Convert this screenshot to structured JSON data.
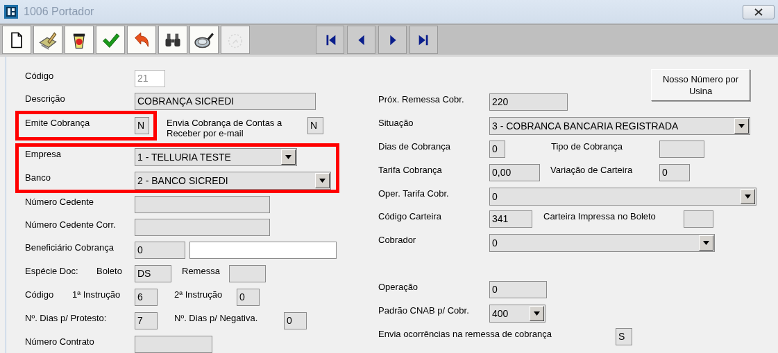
{
  "window": {
    "title": "1006 Portador"
  },
  "toolbar": [
    {
      "disabled": false
    },
    {
      "disabled": false
    },
    {
      "disabled": false
    },
    {
      "disabled": false
    },
    {
      "disabled": false
    },
    {
      "disabled": false
    },
    {
      "disabled": false
    },
    {
      "disabled": true
    }
  ],
  "left_rows": [
    {
      "kind": "row",
      "highlighted": false,
      "cells": [
        {
          "kind": "label",
          "text": "Código"
        },
        {
          "kind": "field",
          "value": "21",
          "readonly": false,
          "disabled": true
        }
      ]
    },
    {
      "kind": "row",
      "highlighted": false,
      "cells": [
        {
          "kind": "label",
          "text": "Descrição"
        },
        {
          "kind": "field",
          "value": "COBRANÇA SICREDI",
          "readonly": true,
          "disabled": false
        }
      ]
    },
    {
      "kind": "row",
      "highlighted": true,
      "cells": [
        {
          "kind": "label",
          "text": "Emite Cobrança"
        },
        {
          "kind": "field",
          "value": "N",
          "readonly": true,
          "disabled": false
        },
        {
          "kind": "label",
          "text": "Envia Cobrança de Contas a Receber por e-mail"
        },
        {
          "kind": "field",
          "value": "N",
          "readonly": true,
          "disabled": false
        }
      ]
    },
    {
      "kind": "group",
      "highlighted": true,
      "rows": [
        {
          "kind": "row",
          "highlighted": false,
          "cells": [
            {
              "kind": "label",
              "text": "Empresa"
            },
            {
              "kind": "combo",
              "value": "1 - TELLURIA TESTE"
            }
          ]
        },
        {
          "kind": "row",
          "highlighted": false,
          "cells": [
            {
              "kind": "label",
              "text": "Banco"
            },
            {
              "kind": "combo",
              "value": "2 - BANCO SICREDI"
            }
          ]
        }
      ]
    },
    {
      "kind": "row",
      "highlighted": false,
      "cells": [
        {
          "kind": "label",
          "text": "Número Cedente"
        },
        {
          "kind": "field",
          "readonly": true,
          "disabled": false
        }
      ]
    },
    {
      "kind": "row",
      "highlighted": false,
      "cells": [
        {
          "kind": "label",
          "text": "Número Cedente Corr."
        },
        {
          "kind": "field",
          "readonly": true,
          "disabled": false
        }
      ]
    },
    {
      "kind": "row",
      "highlighted": false,
      "cells": [
        {
          "kind": "label",
          "text": "Beneficiário Cobrança"
        },
        {
          "kind": "field",
          "value": "0",
          "readonly": true,
          "disabled": false
        },
        {
          "kind": "field",
          "readonly": false,
          "disabled": false
        }
      ]
    },
    {
      "kind": "row",
      "highlighted": false,
      "cells": [
        {
          "kind": "label",
          "text": "Espécie Doc:"
        },
        {
          "kind": "label",
          "text": "Boleto"
        },
        {
          "kind": "field",
          "value": "DS",
          "readonly": true,
          "disabled": false
        },
        {
          "kind": "label",
          "text": "Remessa"
        },
        {
          "kind": "field",
          "readonly": true,
          "disabled": false
        }
      ]
    },
    {
      "kind": "row",
      "highlighted": false,
      "cells": [
        {
          "kind": "label",
          "text": "Código"
        },
        {
          "kind": "label",
          "text": "1ª Instrução"
        },
        {
          "kind": "field",
          "value": "6",
          "readonly": true,
          "disabled": false
        },
        {
          "kind": "label",
          "text": "2ª Instrução"
        },
        {
          "kind": "field",
          "value": "0",
          "readonly": true,
          "disabled": false
        }
      ]
    },
    {
      "kind": "row",
      "highlighted": false,
      "cells": [
        {
          "kind": "label",
          "text": "Nº. Dias p/ Protesto:"
        },
        {
          "kind": "field",
          "value": "7",
          "readonly": true,
          "disabled": false
        },
        {
          "kind": "label",
          "text": "Nº. Dias p/ Negativa."
        },
        {
          "kind": "field",
          "value": "0",
          "readonly": true,
          "disabled": false
        }
      ]
    },
    {
      "kind": "row",
      "highlighted": false,
      "cells": [
        {
          "kind": "label",
          "text": "Número Contrato"
        },
        {
          "kind": "field",
          "readonly": true,
          "disabled": false
        }
      ]
    }
  ],
  "button": {
    "label": "Nosso Número por Usina"
  },
  "right_rows": [
    {
      "kind": "row",
      "highlighted": false,
      "cells": [
        {
          "kind": "label",
          "text": "Próx. Remessa Cobr."
        },
        {
          "kind": "field",
          "value": "220",
          "readonly": true,
          "disabled": false
        }
      ]
    },
    {
      "kind": "row",
      "highlighted": false,
      "cells": [
        {
          "kind": "label",
          "text": "Situação"
        },
        {
          "kind": "combo",
          "value": "3 - COBRANCA BANCARIA REGISTRADA"
        }
      ]
    },
    {
      "kind": "row",
      "highlighted": false,
      "cells": [
        {
          "kind": "label",
          "text": "Dias de Cobrança"
        },
        {
          "kind": "field",
          "value": "0",
          "readonly": true,
          "disabled": false
        },
        {
          "kind": "label",
          "text": "Tipo de Cobrança"
        },
        {
          "kind": "field",
          "readonly": true,
          "disabled": false
        }
      ]
    },
    {
      "kind": "row",
      "highlighted": false,
      "cells": [
        {
          "kind": "label",
          "text": "Tarifa Cobrança"
        },
        {
          "kind": "field",
          "value": "0,00",
          "readonly": true,
          "disabled": false
        },
        {
          "kind": "label",
          "text": "Variação de Carteira"
        },
        {
          "kind": "field",
          "value": "0",
          "readonly": true,
          "disabled": false
        }
      ]
    },
    {
      "kind": "row",
      "highlighted": false,
      "cells": [
        {
          "kind": "label",
          "text": "Oper. Tarifa Cobr."
        },
        {
          "kind": "combo",
          "value": "0"
        }
      ]
    },
    {
      "kind": "row",
      "highlighted": false,
      "cells": [
        {
          "kind": "label",
          "text": "Código Carteira"
        },
        {
          "kind": "field",
          "value": "341",
          "readonly": true,
          "disabled": false
        },
        {
          "kind": "label",
          "text": "Carteira Impressa no Boleto"
        },
        {
          "kind": "field",
          "readonly": true,
          "disabled": false
        }
      ]
    },
    {
      "kind": "row",
      "highlighted": false,
      "cells": [
        {
          "kind": "label",
          "text": "Cobrador"
        },
        {
          "kind": "combo",
          "value": "0"
        }
      ]
    },
    {
      "kind": "row",
      "highlighted": false,
      "cells": [
        {
          "kind": "label",
          "text": "Operação"
        },
        {
          "kind": "field",
          "value": "0",
          "readonly": true,
          "disabled": false
        }
      ]
    },
    {
      "kind": "row",
      "highlighted": false,
      "cells": [
        {
          "kind": "label",
          "text": "Padrão CNAB p/ Cobr."
        },
        {
          "kind": "combo",
          "value": "400"
        }
      ]
    },
    {
      "kind": "row",
      "highlighted": false,
      "cells": [
        {
          "kind": "label",
          "text": "Envia ocorrências na remessa de cobrança"
        },
        {
          "kind": "field",
          "value": "S",
          "readonly": true,
          "disabled": false
        }
      ]
    }
  ]
}
